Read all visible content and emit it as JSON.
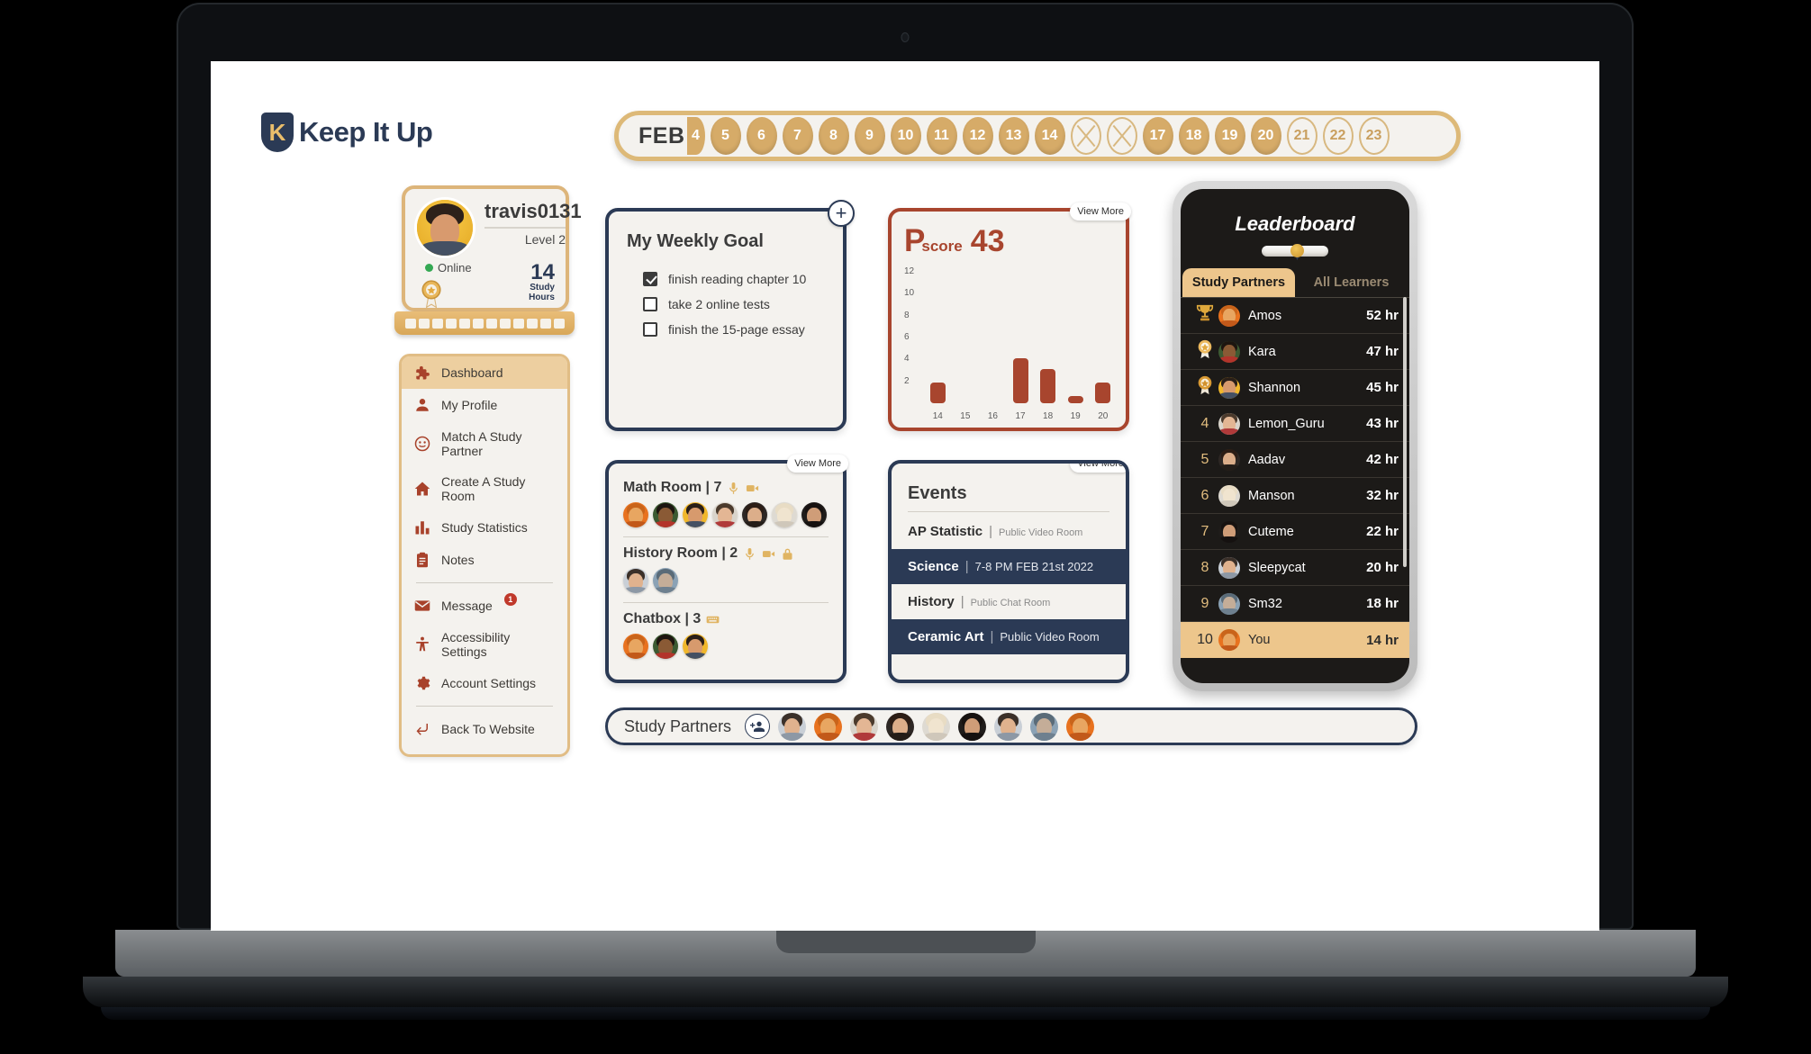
{
  "brand": {
    "logo_letter": "K",
    "name": "Keep It Up"
  },
  "datestrip": {
    "month": "FEB",
    "days": [
      {
        "label": "4",
        "state": "partial"
      },
      {
        "label": "5",
        "state": "filled"
      },
      {
        "label": "6",
        "state": "filled"
      },
      {
        "label": "7",
        "state": "filled"
      },
      {
        "label": "8",
        "state": "filled"
      },
      {
        "label": "9",
        "state": "filled"
      },
      {
        "label": "10",
        "state": "filled"
      },
      {
        "label": "11",
        "state": "filled"
      },
      {
        "label": "12",
        "state": "filled"
      },
      {
        "label": "13",
        "state": "filled"
      },
      {
        "label": "14",
        "state": "filled"
      },
      {
        "label": "15",
        "state": "crossed"
      },
      {
        "label": "16",
        "state": "crossed"
      },
      {
        "label": "17",
        "state": "filled"
      },
      {
        "label": "18",
        "state": "filled"
      },
      {
        "label": "19",
        "state": "filled"
      },
      {
        "label": "20",
        "state": "filled"
      },
      {
        "label": "21",
        "state": "outline"
      },
      {
        "label": "22",
        "state": "outline"
      },
      {
        "label": "23",
        "state": "outline"
      }
    ]
  },
  "profile": {
    "username": "travis0131",
    "level": "Level 2",
    "status": "Online",
    "study_hours_value": "14",
    "study_hours_label_line1": "Study",
    "study_hours_label_line2": "Hours"
  },
  "sidebar": {
    "items": [
      {
        "label": "Dashboard",
        "icon": "puzzle-icon",
        "active": true
      },
      {
        "label": "My Profile",
        "icon": "person-icon",
        "active": false
      },
      {
        "label": "Match A Study Partner",
        "icon": "match-face-icon",
        "active": false
      },
      {
        "label": "Create A Study Room",
        "icon": "home-icon",
        "active": false
      },
      {
        "label": "Study Statistics",
        "icon": "bar-chart-icon",
        "active": false
      },
      {
        "label": "Notes",
        "icon": "clipboard-icon",
        "active": false
      },
      {
        "label": "Message",
        "icon": "envelope-icon",
        "active": false,
        "badge": "1"
      },
      {
        "label": "Accessibility Settings",
        "icon": "accessibility-icon",
        "active": false
      },
      {
        "label": "Account Settings",
        "icon": "gear-icon",
        "active": false
      },
      {
        "label": "Back To Website",
        "icon": "return-arrow-icon",
        "active": false
      }
    ]
  },
  "weekly_goal": {
    "title": "My Weekly Goal",
    "add_label": "+",
    "tasks": [
      {
        "label": "finish reading chapter 10",
        "checked": true
      },
      {
        "label": "take 2 online tests",
        "checked": false
      },
      {
        "label": "finish the 15-page essay",
        "checked": false
      }
    ]
  },
  "pscore": {
    "prefix": "P",
    "suffix": "score",
    "value": "43",
    "view_more": "View More"
  },
  "chart_data": {
    "type": "bar",
    "title": "Pscore 43",
    "categories": [
      "14",
      "15",
      "16",
      "17",
      "18",
      "19",
      "20"
    ],
    "values": [
      1.9,
      0,
      0,
      4.1,
      3.1,
      0.7,
      1.9
    ],
    "xlabel": "",
    "ylabel": "",
    "ylim": [
      0,
      13
    ],
    "yticks": [
      "12",
      "10",
      "8",
      "6",
      "4",
      "2"
    ],
    "ytick_values": [
      12,
      10,
      8,
      6,
      4,
      2
    ],
    "grid": false,
    "legend": false,
    "bar_color": "#a8452e"
  },
  "rooms": {
    "view_more": "View More",
    "list": [
      {
        "name": "Math Room",
        "count": "7",
        "icons": [
          "mic-icon",
          "video-icon"
        ],
        "members": 7
      },
      {
        "name": "History Room",
        "count": "2",
        "icons": [
          "mic-icon",
          "video-icon",
          "lock-icon"
        ],
        "members": 2
      },
      {
        "name": "Chatbox",
        "count": "3",
        "icons": [
          "keyboard-icon"
        ],
        "members": 3
      }
    ]
  },
  "events": {
    "title": "Events",
    "view_more": "View More",
    "list": [
      {
        "name": "AP Statistic",
        "detail": "Public Video Room",
        "highlighted": false
      },
      {
        "name": "Science",
        "detail": "7-8 PM FEB 21st 2022",
        "highlighted": true
      },
      {
        "name": "History",
        "detail": "Public Chat Room",
        "highlighted": false
      },
      {
        "name": "Ceramic Art",
        "detail": "Public Video Room",
        "highlighted": true
      }
    ]
  },
  "leaderboard": {
    "title": "Leaderboard",
    "tabs": [
      {
        "label": "Study Partners",
        "active": true
      },
      {
        "label": "All Learners",
        "active": false
      }
    ],
    "rows": [
      {
        "rank": "1",
        "medal": "trophy-icon",
        "name": "Amos",
        "hours": "52 hr",
        "me": false
      },
      {
        "rank": "2",
        "medal": "silver-medal-icon",
        "name": "Kara",
        "hours": "47 hr",
        "me": false
      },
      {
        "rank": "3",
        "medal": "bronze-medal-icon",
        "name": "Shannon",
        "hours": "45 hr",
        "me": false
      },
      {
        "rank": "4",
        "medal": "",
        "name": "Lemon_Guru",
        "hours": "43 hr",
        "me": false
      },
      {
        "rank": "5",
        "medal": "",
        "name": "Aadav",
        "hours": "42 hr",
        "me": false
      },
      {
        "rank": "6",
        "medal": "",
        "name": "Manson",
        "hours": "32 hr",
        "me": false
      },
      {
        "rank": "7",
        "medal": "",
        "name": "Cuteme",
        "hours": "22 hr",
        "me": false
      },
      {
        "rank": "8",
        "medal": "",
        "name": "Sleepycat",
        "hours": "20 hr",
        "me": false
      },
      {
        "rank": "9",
        "medal": "",
        "name": "Sm32",
        "hours": "18 hr",
        "me": false
      },
      {
        "rank": "10",
        "medal": "",
        "name": "You",
        "hours": "14 hr",
        "me": true
      }
    ]
  },
  "study_partners": {
    "label": "Study Partners",
    "add_icon": "add-person-icon",
    "avatar_count": 9
  },
  "colors": {
    "navy": "#2b3a55",
    "rust": "#a8452e",
    "gold": "#d6ab68",
    "gold_light": "#edc68c",
    "card_bg": "#f4f2ee",
    "sidebar_accent": "#edcfa0",
    "online_green": "#34a853"
  }
}
